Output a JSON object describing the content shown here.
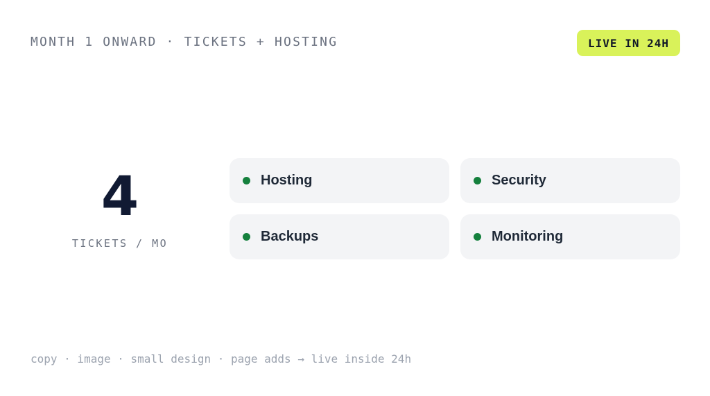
{
  "header": {
    "eyebrow": "MONTH 1 ONWARD · TICKETS + HOSTING",
    "badge_label": "LIVE IN 24H"
  },
  "stat": {
    "value": "4",
    "label": "TICKETS / MO"
  },
  "features": [
    {
      "label": "Hosting"
    },
    {
      "label": "Security"
    },
    {
      "label": "Backups"
    },
    {
      "label": "Monitoring"
    }
  ],
  "footer": {
    "note": "copy · image · small design · page adds → live inside 24h"
  },
  "colors": {
    "badge_background": "#d9f25a",
    "status_dot": "#15803d",
    "stat_number": "#111a33",
    "card_background": "#f3f4f6"
  }
}
